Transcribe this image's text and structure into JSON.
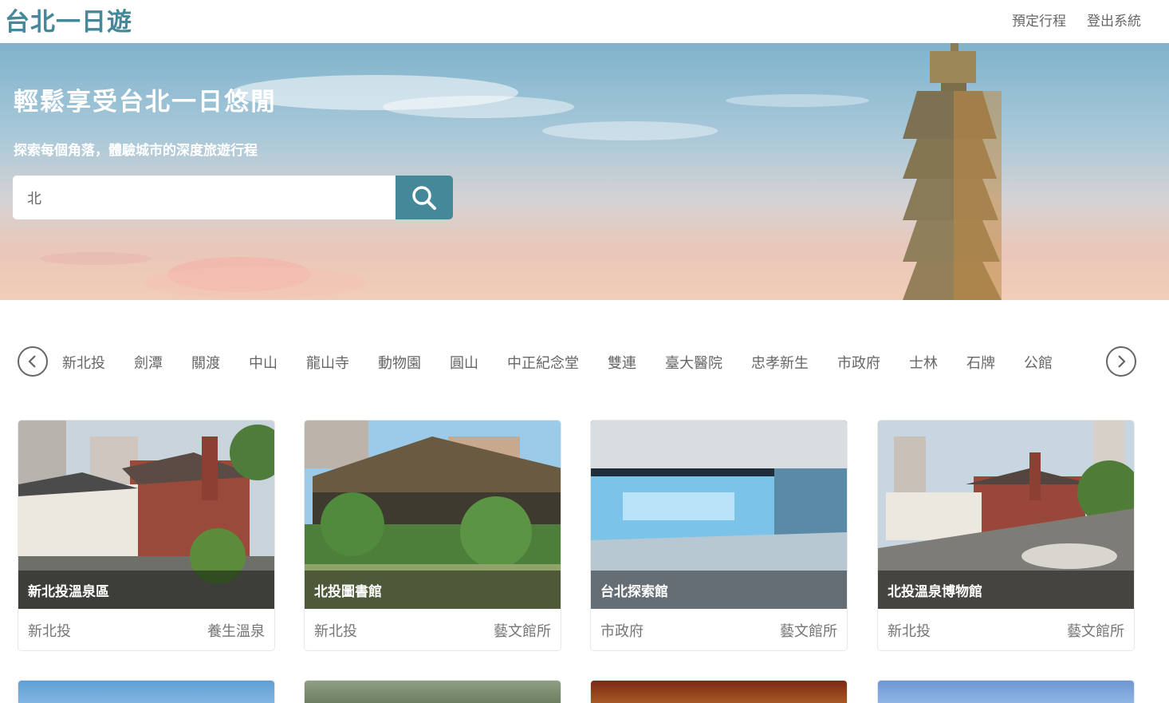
{
  "header": {
    "brand": "台北一日遊",
    "nav": [
      "預定行程",
      "登出系統"
    ]
  },
  "hero": {
    "title": "輕鬆享受台北一日悠閒",
    "subtitle": "探索每個角落，體驗城市的深度旅遊行程",
    "search_value": "北"
  },
  "mrt": {
    "stations": [
      "新北投",
      "劍潭",
      "關渡",
      "中山",
      "龍山寺",
      "動物園",
      "圓山",
      "中正紀念堂",
      "雙連",
      "臺大醫院",
      "忠孝新生",
      "市政府",
      "士林",
      "石牌",
      "公館"
    ]
  },
  "attractions": [
    {
      "name": "新北投溫泉區",
      "mrt": "新北投",
      "category": "養生溫泉"
    },
    {
      "name": "北投圖書館",
      "mrt": "新北投",
      "category": "藝文館所"
    },
    {
      "name": "台北探索館",
      "mrt": "市政府",
      "category": "藝文館所"
    },
    {
      "name": "北投溫泉博物館",
      "mrt": "新北投",
      "category": "藝文館所"
    }
  ],
  "colors": {
    "brand": "#448899",
    "text_muted": "#757575"
  },
  "icons": {
    "search": "search-icon",
    "prev": "chevron-left-icon",
    "next": "chevron-right-icon"
  }
}
